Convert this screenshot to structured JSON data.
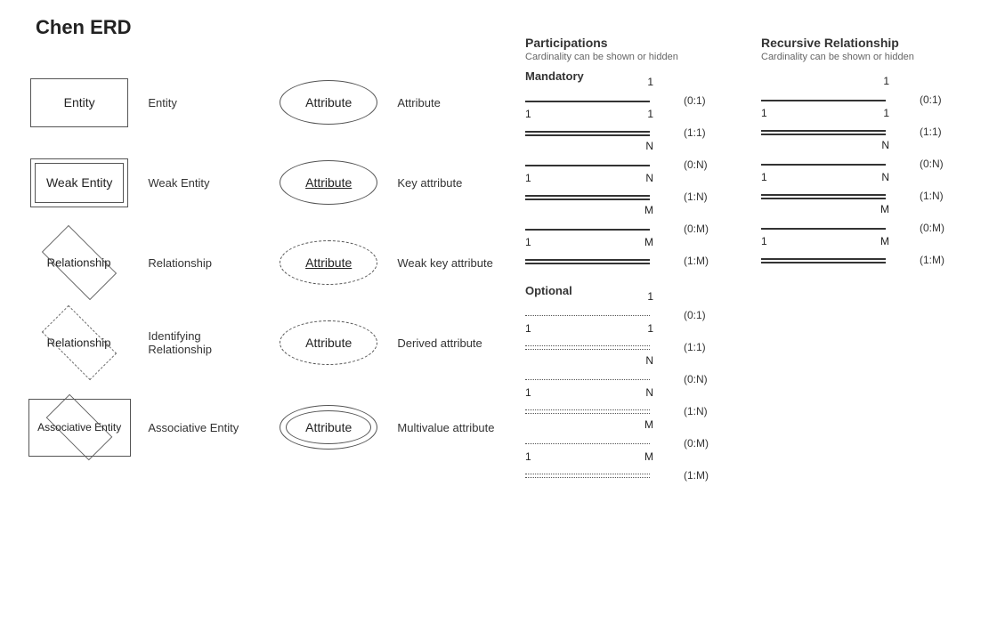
{
  "title": "Chen ERD",
  "shapes": {
    "entities": [
      {
        "id": "entity",
        "label": "Entity",
        "desc": "Entity",
        "type": "simple-rect"
      },
      {
        "id": "weak-entity",
        "label": "Weak Entity",
        "desc": "Weak Entity",
        "type": "double-rect"
      },
      {
        "id": "relationship",
        "label": "Relationship",
        "desc": "Relationship",
        "type": "diamond"
      },
      {
        "id": "identifying-relationship",
        "label": "Relationship",
        "desc": "Identifying Relationship",
        "type": "dashed-diamond"
      },
      {
        "id": "associative-entity",
        "label": "Associative Entity",
        "desc": "Associative Entity",
        "type": "assoc"
      }
    ],
    "attributes": [
      {
        "id": "attribute",
        "label": "Attribute",
        "desc": "Attribute",
        "type": "ellipse"
      },
      {
        "id": "key-attribute",
        "label": "Attribute",
        "desc": "Key attribute",
        "type": "key-ellipse"
      },
      {
        "id": "weak-key-attribute",
        "label": "Attribute",
        "desc": "Weak key attribute",
        "type": "dashed-key-ellipse"
      },
      {
        "id": "derived-attribute",
        "label": "Attribute",
        "desc": "Derived attribute",
        "type": "dashed-ellipse"
      },
      {
        "id": "multivalue-attribute",
        "label": "Attribute",
        "desc": "Multivalue attribute",
        "type": "double-ellipse"
      }
    ]
  },
  "participations": {
    "title": "Participations",
    "subtitle": "Cardinality can be shown or hidden",
    "mandatory": {
      "label": "Mandatory",
      "rows": [
        {
          "numLeft": "",
          "numRight": "1",
          "cardinality": "(0:1)",
          "lineType": "solid"
        },
        {
          "numLeft": "1",
          "numRight": "1",
          "cardinality": "(1:1)",
          "lineType": "solid-double"
        },
        {
          "numLeft": "",
          "numRight": "N",
          "cardinality": "(0:N)",
          "lineType": "solid"
        },
        {
          "numLeft": "1",
          "numRight": "N",
          "cardinality": "(1:N)",
          "lineType": "solid-double"
        },
        {
          "numLeft": "",
          "numRight": "M",
          "cardinality": "(0:M)",
          "lineType": "solid"
        },
        {
          "numLeft": "1",
          "numRight": "M",
          "cardinality": "(1:M)",
          "lineType": "solid-double"
        }
      ]
    },
    "optional": {
      "label": "Optional",
      "rows": [
        {
          "numLeft": "",
          "numRight": "1",
          "cardinality": "(0:1)",
          "lineType": "dotted"
        },
        {
          "numLeft": "1",
          "numRight": "1",
          "cardinality": "(1:1)",
          "lineType": "dotted-double"
        },
        {
          "numLeft": "",
          "numRight": "N",
          "cardinality": "(0:N)",
          "lineType": "dotted"
        },
        {
          "numLeft": "1",
          "numRight": "N",
          "cardinality": "(1:N)",
          "lineType": "dotted-double"
        },
        {
          "numLeft": "",
          "numRight": "M",
          "cardinality": "(0:M)",
          "lineType": "dotted"
        },
        {
          "numLeft": "1",
          "numRight": "M",
          "cardinality": "(1:M)",
          "lineType": "dotted-double"
        }
      ]
    }
  },
  "recursive": {
    "title": "Recursive Relationship",
    "subtitle": "Cardinality can be shown or hidden",
    "mandatory": {
      "rows": [
        {
          "numLeft": "",
          "numRight": "1",
          "cardinality": "(0:1)",
          "lineType": "solid"
        },
        {
          "numLeft": "1",
          "numRight": "1",
          "cardinality": "(1:1)",
          "lineType": "solid-double"
        },
        {
          "numLeft": "",
          "numRight": "N",
          "cardinality": "(0:N)",
          "lineType": "solid"
        },
        {
          "numLeft": "1",
          "numRight": "N",
          "cardinality": "(1:N)",
          "lineType": "solid-double"
        },
        {
          "numLeft": "",
          "numRight": "M",
          "cardinality": "(0:M)",
          "lineType": "solid"
        },
        {
          "numLeft": "1",
          "numRight": "M",
          "cardinality": "(1:M)",
          "lineType": "solid-double"
        }
      ]
    }
  }
}
